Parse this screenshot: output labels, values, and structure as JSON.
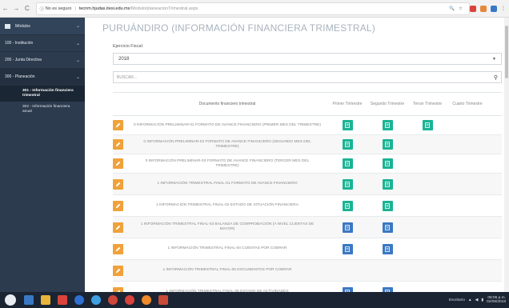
{
  "browser": {
    "security": "No es seguro",
    "host": "tecnm.hjudas.itesi.edu.mx",
    "path": "/Modulo/planeacionTrimestral.aspx"
  },
  "sidebar": {
    "header": "Módulos",
    "items": [
      {
        "label": "100 - Institución"
      },
      {
        "label": "200 - Junta Directiva"
      },
      {
        "label": "300 - Planeación"
      }
    ],
    "subitems": [
      {
        "label": "301 - Información financiera trimestral"
      },
      {
        "label": "302 - Información financiera anual"
      }
    ]
  },
  "main": {
    "title": "PURUÁNDIRO (INFORMACIÓN FINANCIERA TRIMESTRAL)",
    "fiscal_label": "Ejercicio Fiscal:",
    "fiscal_value": "2018",
    "search_placeholder": "BUSCAR...",
    "columns": {
      "doc": "Documento financiero trimestral",
      "q1": "Primer Trimestre",
      "q2": "Segundo Trimestre",
      "q3": "Tercer Trimestre",
      "q4": "Cuarto Trimestre"
    },
    "rows": [
      {
        "doc": "0 INFORMACIÓN PRELIMINAR-01 FORMATO DE AVANCE FINANCIERO (PRIMER MES DEL TRIMESTRE)",
        "q": [
          "teal",
          "teal",
          "teal",
          ""
        ]
      },
      {
        "doc": "0 INFORMACIÓN PRELIMINAR-02 FORMATO DE AVANCE FINANCIERO (SEGUNDO MES DEL TRIMESTRE)",
        "q": [
          "teal",
          "teal",
          "",
          ""
        ]
      },
      {
        "doc": "0 INFORMACIÓN PRELIMINAR-03 FORMATO DE AVANCE FINANCIERO (TERCER MES DEL TRIMESTRE)",
        "q": [
          "teal",
          "teal",
          "",
          ""
        ]
      },
      {
        "doc": "1 INFORMACIÓN TRIMESTRAL FINAL-01 FORMATO DE AVANCE FINANCIERO",
        "q": [
          "teal",
          "teal",
          "",
          ""
        ]
      },
      {
        "doc": "1 INFORMACIÓN TRIMESTRAL FINAL-02 ESTADO DE SITUACIÓN FINANCIERA",
        "q": [
          "teal",
          "teal",
          "",
          ""
        ]
      },
      {
        "doc": "1 INFORMACIÓN TRIMESTRAL FINAL-03 BALANZA DE COMPROBACIÓN (A NIVEL CUENTAS DE MAYOR)",
        "q": [
          "blue",
          "blue",
          "",
          ""
        ]
      },
      {
        "doc": "1 INFORMACIÓN TRIMESTRAL FINAL-04 CUENTAS POR COBRAR",
        "q": [
          "blue",
          "blue",
          "",
          ""
        ]
      },
      {
        "doc": "1 INFORMACIÓN TRIMESTRAL FINAL-05 DOCUMENTOS POR COBRAR",
        "q": [
          "",
          "",
          "",
          ""
        ]
      },
      {
        "doc": "1 INFORMACIÓN TRIMESTRAL FINAL-06 ESTADO DE ACTIVIDADES",
        "q": [
          "blue",
          "blue",
          "",
          ""
        ]
      }
    ]
  },
  "taskbar": {
    "tray_label": "Escritorio",
    "time": "08:06 p.m.",
    "date": "02/08/2018"
  },
  "colors": {
    "teal": "#1ab394",
    "blue": "#3a78c3",
    "edit": "#f0a13a",
    "sidebar": "#2c3b4e"
  }
}
